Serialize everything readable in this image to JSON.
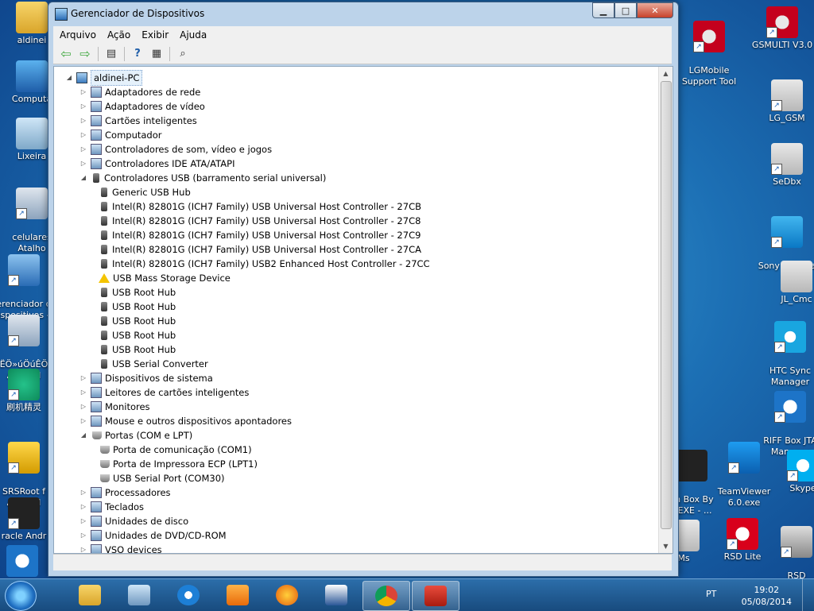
{
  "desktop": {
    "left_icons": [
      {
        "label": "aldinei",
        "icon": "user-folder-icon"
      },
      {
        "label": "Computa",
        "icon": "computer-icon"
      },
      {
        "label": "Lixeira",
        "icon": "recycle-bin-icon"
      },
      {
        "label": "celulares\nAtalho",
        "icon": "phone-icon"
      },
      {
        "label": "erenciador d\nispositivos -",
        "icon": "device-manager-icon"
      },
      {
        "label": "ËÖ»úÖúÊÖ\nAndroid",
        "icon": "android-phone-icon"
      },
      {
        "label": "刷机精灵",
        "icon": "shuaji-icon"
      },
      {
        "label": "SRSRoot f\nAndroid",
        "icon": "lock-icon"
      },
      {
        "label": "racle Andr",
        "icon": "oracle-tool-icon"
      },
      {
        "label": "",
        "icon": "rbox-icon"
      }
    ],
    "right_icons": [
      {
        "label": "LGMobile\nSupport Tool",
        "icon": "lg-icon"
      },
      {
        "label": "GSMULTI V3.0",
        "icon": "lg-icon"
      },
      {
        "label": "LG_GSM",
        "icon": "sedbx-icon"
      },
      {
        "label": "SeDbx",
        "icon": "sedbx-icon"
      },
      {
        "label": "Sony Bootloa\nUn",
        "icon": "sony-unlock-icon"
      },
      {
        "label": "JL_Cmc",
        "icon": "chip-icon"
      },
      {
        "label": "HTC Sync\nManager",
        "icon": "htc-icon"
      },
      {
        "label": "RIFF Box JTA\nManager",
        "icon": "riff-icon"
      },
      {
        "label": "on Box By\nY.EXE - ...",
        "icon": "dragon-icon"
      },
      {
        "label": "TeamViewer\n6.0.exe",
        "icon": "teamviewer-icon"
      },
      {
        "label": "Skype",
        "icon": "skype-icon"
      },
      {
        "label": "Ms",
        "icon": "sedbx-icon"
      },
      {
        "label": "RSD Lite",
        "icon": "motorola-icon"
      },
      {
        "label": "RSD\nNetConnec",
        "icon": "rsd-net-icon"
      }
    ]
  },
  "window": {
    "title": "Gerenciador de Dispositivos",
    "buttons": {
      "minimize": "▁",
      "maximize": "□",
      "close": "✕"
    },
    "menu": [
      "Arquivo",
      "Ação",
      "Exibir",
      "Ajuda"
    ],
    "tree": {
      "root": "aldinei-PC",
      "rows": [
        {
          "text": "aldinei-PC",
          "level": 0,
          "exp": "open",
          "icon": "pc",
          "selected": true
        },
        {
          "text": "Adaptadores de rede",
          "level": 1,
          "exp": "closed",
          "icon": "cat"
        },
        {
          "text": "Adaptadores de vídeo",
          "level": 1,
          "exp": "closed",
          "icon": "cat"
        },
        {
          "text": "Cartões inteligentes",
          "level": 1,
          "exp": "closed",
          "icon": "cat"
        },
        {
          "text": "Computador",
          "level": 1,
          "exp": "closed",
          "icon": "cat"
        },
        {
          "text": "Controladores de som, vídeo e jogos",
          "level": 1,
          "exp": "closed",
          "icon": "cat"
        },
        {
          "text": "Controladores IDE ATA/ATAPI",
          "level": 1,
          "exp": "closed",
          "icon": "cat"
        },
        {
          "text": "Controladores USB (barramento serial universal)",
          "level": 1,
          "exp": "open",
          "icon": "usb"
        },
        {
          "text": "Generic USB Hub",
          "level": 2,
          "exp": "none",
          "icon": "usb"
        },
        {
          "text": "Intel(R) 82801G (ICH7 Family) USB Universal Host Controller - 27CB",
          "level": 2,
          "exp": "none",
          "icon": "usb"
        },
        {
          "text": "Intel(R) 82801G (ICH7 Family) USB Universal Host Controller - 27C8",
          "level": 2,
          "exp": "none",
          "icon": "usb"
        },
        {
          "text": "Intel(R) 82801G (ICH7 Family) USB Universal Host Controller - 27C9",
          "level": 2,
          "exp": "none",
          "icon": "usb"
        },
        {
          "text": "Intel(R) 82801G (ICH7 Family) USB Universal Host Controller - 27CA",
          "level": 2,
          "exp": "none",
          "icon": "usb"
        },
        {
          "text": "Intel(R) 82801G (ICH7 Family) USB2 Enhanced Host Controller - 27CC",
          "level": 2,
          "exp": "none",
          "icon": "usb"
        },
        {
          "text": "USB Mass Storage Device",
          "level": 2,
          "exp": "none",
          "icon": "warn"
        },
        {
          "text": "USB Root Hub",
          "level": 2,
          "exp": "none",
          "icon": "usb"
        },
        {
          "text": "USB Root Hub",
          "level": 2,
          "exp": "none",
          "icon": "usb"
        },
        {
          "text": "USB Root Hub",
          "level": 2,
          "exp": "none",
          "icon": "usb"
        },
        {
          "text": "USB Root Hub",
          "level": 2,
          "exp": "none",
          "icon": "usb"
        },
        {
          "text": "USB Root Hub",
          "level": 2,
          "exp": "none",
          "icon": "usb"
        },
        {
          "text": "USB Serial Converter",
          "level": 2,
          "exp": "none",
          "icon": "usb"
        },
        {
          "text": "Dispositivos de sistema",
          "level": 1,
          "exp": "closed",
          "icon": "cat"
        },
        {
          "text": "Leitores de cartões inteligentes",
          "level": 1,
          "exp": "closed",
          "icon": "cat"
        },
        {
          "text": "Monitores",
          "level": 1,
          "exp": "closed",
          "icon": "cat"
        },
        {
          "text": "Mouse e outros dispositivos apontadores",
          "level": 1,
          "exp": "closed",
          "icon": "cat"
        },
        {
          "text": "Portas (COM e LPT)",
          "level": 1,
          "exp": "open",
          "icon": "port"
        },
        {
          "text": "Porta de comunicação (COM1)",
          "level": 2,
          "exp": "none",
          "icon": "port"
        },
        {
          "text": "Porta de Impressora ECP (LPT1)",
          "level": 2,
          "exp": "none",
          "icon": "port"
        },
        {
          "text": "USB Serial Port (COM30)",
          "level": 2,
          "exp": "none",
          "icon": "port"
        },
        {
          "text": "Processadores",
          "level": 1,
          "exp": "closed",
          "icon": "cat"
        },
        {
          "text": "Teclados",
          "level": 1,
          "exp": "closed",
          "icon": "cat"
        },
        {
          "text": "Unidades de disco",
          "level": 1,
          "exp": "closed",
          "icon": "cat"
        },
        {
          "text": "Unidades de DVD/CD-ROM",
          "level": 1,
          "exp": "closed",
          "icon": "cat"
        },
        {
          "text": "VSO devices",
          "level": 1,
          "exp": "closed",
          "icon": "cat"
        }
      ]
    }
  },
  "taskbar": {
    "apps": [
      "explorer-icon",
      "pencil-icon",
      "ie-icon",
      "media-icon",
      "firefox-icon",
      "word-icon",
      "chrome-icon",
      "toolbox-icon"
    ],
    "active_app": 7,
    "language": "PT",
    "time": "19:02",
    "date": "05/08/2014"
  },
  "colors": {
    "selection": "#e5f1fb",
    "titlebar": "#bcd3ea",
    "taskbar": "#184b7e"
  }
}
